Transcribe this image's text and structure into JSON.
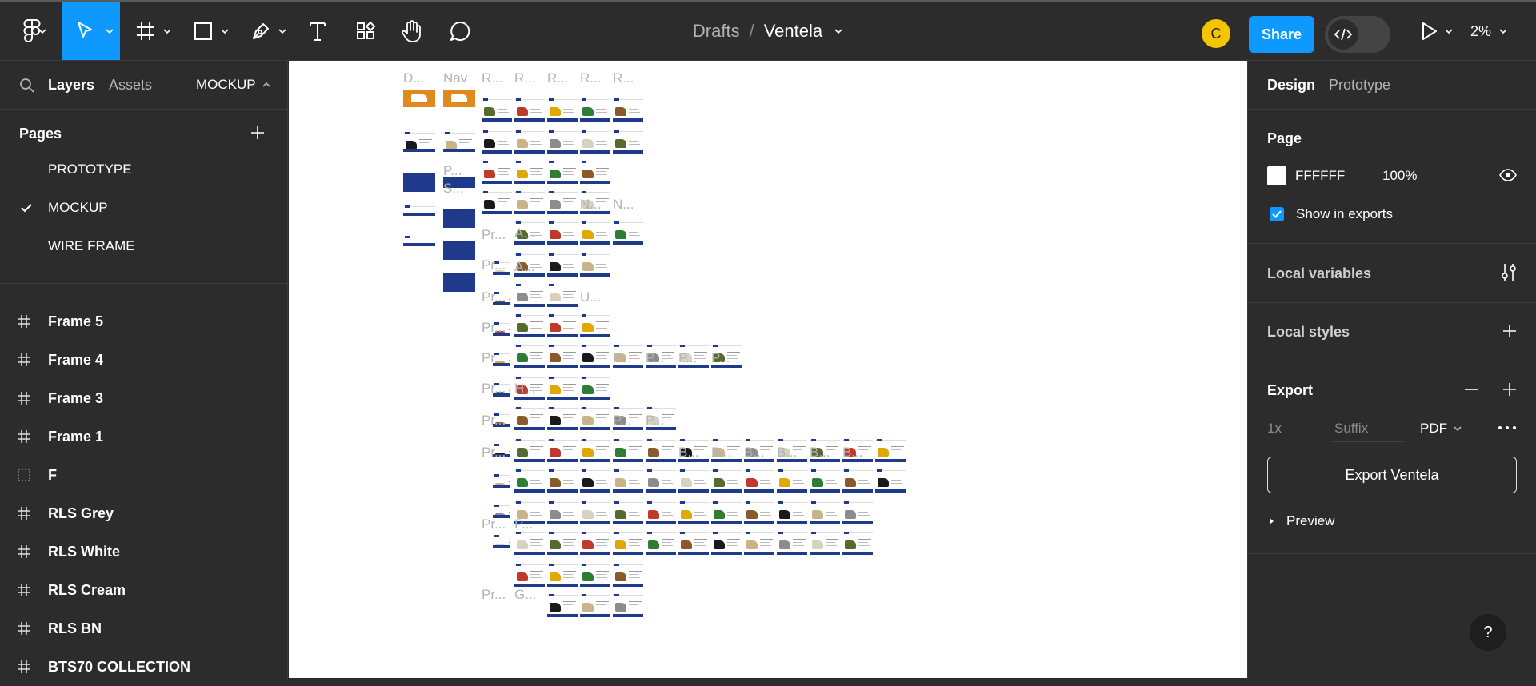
{
  "toolbar": {
    "breadcrumb_parent": "Drafts",
    "breadcrumb_sep": "/",
    "file_name": "Ventela",
    "avatar_initial": "C",
    "share_label": "Share",
    "zoom_label": "2%",
    "tools": [
      "figma-menu-icon",
      "move-tool-icon",
      "frame-tool-icon",
      "rectangle-tool-icon",
      "pen-tool-icon",
      "text-tool-icon",
      "resources-icon",
      "hand-tool-icon",
      "comment-icon"
    ]
  },
  "left_panel": {
    "tab_layers": "Layers",
    "tab_assets": "Assets",
    "current_page": "MOCKUP",
    "pages_heading": "Pages",
    "pages": [
      {
        "label": "PROTOTYPE",
        "selected": false
      },
      {
        "label": "MOCKUP",
        "selected": true
      },
      {
        "label": "WIRE FRAME",
        "selected": false
      }
    ],
    "layers": [
      {
        "label": "Frame 5",
        "icon": "frame-icon"
      },
      {
        "label": "Frame 4",
        "icon": "frame-icon"
      },
      {
        "label": "Frame 3",
        "icon": "frame-icon"
      },
      {
        "label": "Frame 1",
        "icon": "frame-icon"
      },
      {
        "label": "F",
        "icon": "section-icon"
      },
      {
        "label": "RLS Grey",
        "icon": "frame-icon"
      },
      {
        "label": "RLS White",
        "icon": "frame-icon"
      },
      {
        "label": "RLS Cream",
        "icon": "frame-icon"
      },
      {
        "label": "RLS BN",
        "icon": "frame-icon"
      },
      {
        "label": "BTS70 COLLECTION",
        "icon": "frame-icon"
      }
    ]
  },
  "right_panel": {
    "tab_design": "Design",
    "tab_prototype": "Prototype",
    "page_heading": "Page",
    "page_color": "FFFFFF",
    "page_opacity": "100%",
    "show_in_exports": "Show in exports",
    "local_variables": "Local variables",
    "local_styles": "Local styles",
    "export_heading": "Export",
    "export_scale": "1x",
    "export_suffix": "Suffix",
    "export_format": "PDF",
    "export_button": "Export Ventela",
    "preview_label": "Preview",
    "help_label": "?"
  },
  "canvas": {
    "frame_labels": [
      "D...",
      "Nav",
      "R...",
      "R...",
      "R...",
      "R...",
      "R...",
      "P...",
      "S...",
      "N...",
      "N...",
      "Pr...",
      "A...",
      "Pr...",
      "A...",
      "Pr...",
      "U...",
      "Pr...",
      "Pr...",
      "P...",
      "P...",
      "P...",
      "P...",
      "Pr...",
      "H...",
      "Pr...",
      "P...",
      "P...",
      "Pr...",
      "B...",
      "B...",
      "B...",
      "B...",
      "B...",
      "B...",
      "Pr...",
      "P...",
      "Pr...",
      "G..."
    ],
    "accent_blue": "#1f3a8a",
    "shoe_colors": [
      "#1a1a1a",
      "#c9b48a",
      "#8c8c8c",
      "#d9d1c0",
      "#556b2f",
      "#c0392b",
      "#e0a800",
      "#2e7d32",
      "#8b5a2b"
    ]
  },
  "colors": {
    "panel_bg": "#2c2c2c",
    "active_tool": "#0d99ff",
    "share_button": "#0d99ff",
    "avatar": "#f5c400",
    "canvas_bg": "#ffffff",
    "checkbox": "#0d99ff"
  }
}
